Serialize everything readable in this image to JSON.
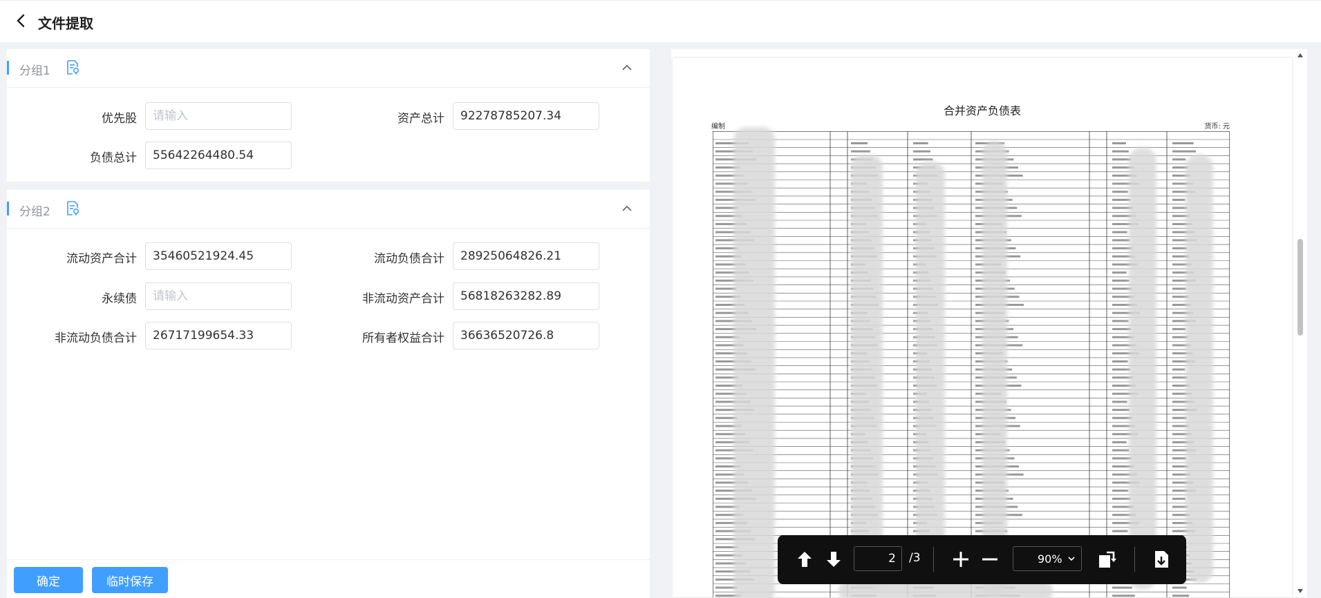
{
  "header": {
    "title": "文件提取"
  },
  "groups": [
    {
      "name": "分组1",
      "fields": [
        {
          "label": "优先股",
          "value": "",
          "placeholder": "请输入"
        },
        {
          "label": "资产总计",
          "value": "92278785207.34",
          "placeholder": "请输入"
        },
        {
          "label": "负债总计",
          "value": "55642264480.54",
          "placeholder": "请输入"
        }
      ]
    },
    {
      "name": "分组2",
      "fields": [
        {
          "label": "流动资产合计",
          "value": "35460521924.45",
          "placeholder": "请输入"
        },
        {
          "label": "流动负债合计",
          "value": "28925064826.21",
          "placeholder": "请输入"
        },
        {
          "label": "永续债",
          "value": "",
          "placeholder": "请输入"
        },
        {
          "label": "非流动资产合计",
          "value": "56818263282.89",
          "placeholder": "请输入"
        },
        {
          "label": "非流动负债合计",
          "value": "26717199654.33",
          "placeholder": "请输入"
        },
        {
          "label": "所有者权益合计",
          "value": "36636520726.8",
          "placeholder": "请输入"
        }
      ]
    }
  ],
  "actions": {
    "confirm": "确定",
    "temp_save": "临时保存"
  },
  "viewer": {
    "doc_title": "合并资产负债表",
    "doc_unit": "货币: 元",
    "doc_prefix": "编制",
    "page_current": "2",
    "page_total": "/3",
    "zoom": "90%",
    "zoom_options": [
      "90%"
    ]
  },
  "colors": {
    "primary": "#409eff",
    "toolbar_bg": "#101010"
  }
}
